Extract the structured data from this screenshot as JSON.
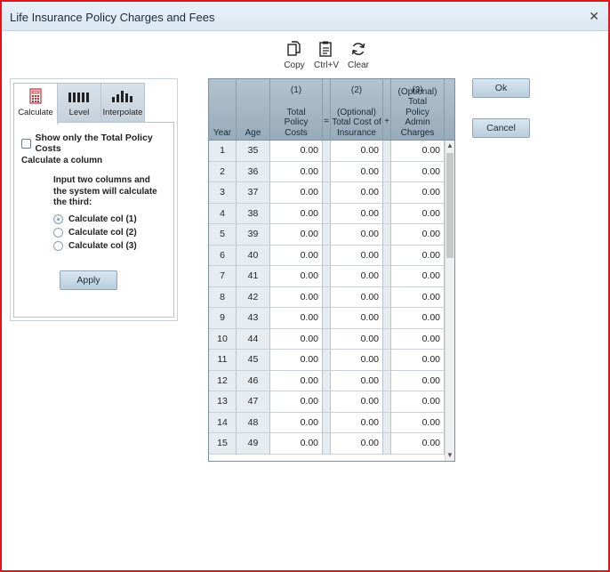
{
  "window": {
    "title": "Life Insurance Policy Charges and Fees"
  },
  "toolbar": {
    "copy_label": "Copy",
    "paste_label": "Ctrl+V",
    "clear_label": "Clear"
  },
  "tabs": [
    {
      "label": "Calculate",
      "icon": "calculator-icon",
      "active": true
    },
    {
      "label": "Level",
      "icon": "level-bars-icon",
      "active": false
    },
    {
      "label": "Interpolate",
      "icon": "interpolate-bars-icon",
      "active": false
    }
  ],
  "calculate_panel": {
    "show_only_total_label": "Show only the Total Policy Costs",
    "show_only_total_checked": false,
    "calculate_column_label": "Calculate a column",
    "instructions": "Input two columns and the system will calculate the third:",
    "options": [
      {
        "label": "Calculate col (1)",
        "selected": true
      },
      {
        "label": "Calculate col (2)",
        "selected": false
      },
      {
        "label": "Calculate col (3)",
        "selected": false
      }
    ],
    "apply_label": "Apply"
  },
  "grid": {
    "headers": {
      "year": "Year",
      "age": "Age",
      "col1_num": "(1)",
      "col1_label": "Total Policy Costs",
      "equals": "=",
      "col2_num": "(2)",
      "col2_label": "(Optional) Total Cost of Insurance",
      "plus": "+",
      "col3_num": "(3)",
      "col3_label": "(Optional) Total Policy Admin Charges"
    },
    "rows": [
      {
        "year": "1",
        "age": "35",
        "col1": "0.00",
        "col2": "0.00",
        "col3": "0.00"
      },
      {
        "year": "2",
        "age": "36",
        "col1": "0.00",
        "col2": "0.00",
        "col3": "0.00"
      },
      {
        "year": "3",
        "age": "37",
        "col1": "0.00",
        "col2": "0.00",
        "col3": "0.00"
      },
      {
        "year": "4",
        "age": "38",
        "col1": "0.00",
        "col2": "0.00",
        "col3": "0.00"
      },
      {
        "year": "5",
        "age": "39",
        "col1": "0.00",
        "col2": "0.00",
        "col3": "0.00"
      },
      {
        "year": "6",
        "age": "40",
        "col1": "0.00",
        "col2": "0.00",
        "col3": "0.00"
      },
      {
        "year": "7",
        "age": "41",
        "col1": "0.00",
        "col2": "0.00",
        "col3": "0.00"
      },
      {
        "year": "8",
        "age": "42",
        "col1": "0.00",
        "col2": "0.00",
        "col3": "0.00"
      },
      {
        "year": "9",
        "age": "43",
        "col1": "0.00",
        "col2": "0.00",
        "col3": "0.00"
      },
      {
        "year": "10",
        "age": "44",
        "col1": "0.00",
        "col2": "0.00",
        "col3": "0.00"
      },
      {
        "year": "11",
        "age": "45",
        "col1": "0.00",
        "col2": "0.00",
        "col3": "0.00"
      },
      {
        "year": "12",
        "age": "46",
        "col1": "0.00",
        "col2": "0.00",
        "col3": "0.00"
      },
      {
        "year": "13",
        "age": "47",
        "col1": "0.00",
        "col2": "0.00",
        "col3": "0.00"
      },
      {
        "year": "14",
        "age": "48",
        "col1": "0.00",
        "col2": "0.00",
        "col3": "0.00"
      },
      {
        "year": "15",
        "age": "49",
        "col1": "0.00",
        "col2": "0.00",
        "col3": "0.00"
      }
    ]
  },
  "dialog_buttons": {
    "ok_label": "Ok",
    "cancel_label": "Cancel"
  },
  "colors": {
    "frame_border": "#e0161b",
    "header_bg": "#a6b8c5",
    "button_bg": "#c8dae8"
  }
}
